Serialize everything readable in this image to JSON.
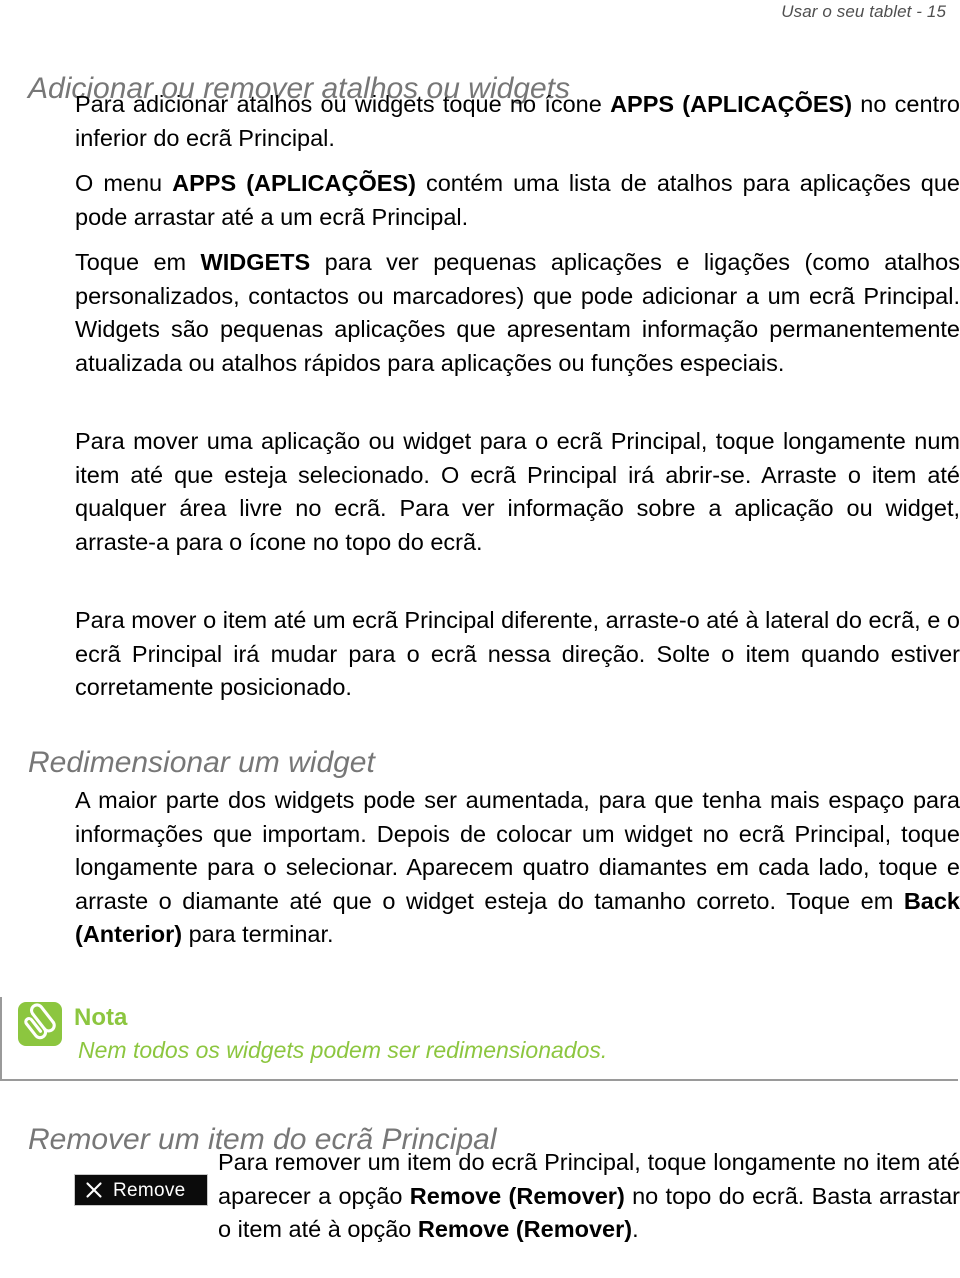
{
  "header": {
    "running_head": "Usar o seu tablet - 15"
  },
  "colors": {
    "heading_gray": "#777777",
    "note_green": "#8cc63f",
    "note_border": "#9a9a9a",
    "body_black": "#000000",
    "remove_button_bg": "#0b0b0b"
  },
  "sections": {
    "add_remove": {
      "heading": "Adicionar ou remover atalhos ou widgets",
      "paragraphs": {
        "p1_a": "Para adicionar atalhos ou widgets toque no ícone ",
        "p1_bold": "APPS (APLICAÇÕES)",
        "p1_b": " no centro inferior do ecrã Principal.",
        "p2_a": "O menu ",
        "p2_bold": "APPS (APLICAÇÕES)",
        "p2_b": " contém uma lista de atalhos para aplicações que pode arrastar até a um ecrã Principal.",
        "p3_a": "Toque em ",
        "p3_bold": "WIDGETS",
        "p3_b": " para ver pequenas aplicações e ligações (como atalhos personalizados, contactos ou marcadores) que pode adicionar a um ecrã Principal. Widgets são pequenas aplicações que apresentam informação permanentemente atualizada ou atalhos rápidos para aplicações ou funções especiais.",
        "p4": "Para mover uma aplicação ou widget para o ecrã Principal, toque longamente num item até que esteja selecionado. O ecrã Principal irá abrir-se. Arraste o item até qualquer área livre no ecrã. Para ver informação sobre a aplicação ou widget, arraste-a para o ícone no topo do ecrã.",
        "p5": "Para mover o item até um ecrã Principal diferente, arraste-o até à lateral do ecrã, e o ecrã Principal irá mudar para o ecrã nessa direção. Solte o item quando estiver corretamente posicionado."
      }
    },
    "resize": {
      "heading": "Redimensionar um widget",
      "paragraph_a": "A maior parte dos widgets pode ser aumentada, para que tenha mais espaço para informações que importam. Depois de colocar um widget no ecrã Principal, toque longamente para o selecionar. Aparecem quatro diamantes em cada lado, toque e arraste o diamante até que o widget esteja do tamanho correto. Toque em ",
      "paragraph_bold": "Back (Anterior)",
      "paragraph_b": " para terminar."
    },
    "note": {
      "icon_name": "paperclip-icon",
      "title": "Nota",
      "text": "Nem todos os widgets podem ser redimensionados."
    },
    "remove_item": {
      "heading": "Remover um item do ecrã Principal",
      "button": {
        "icon_name": "close-x-icon",
        "label": "Remove"
      },
      "paragraph_a": "Para remover um item do ecrã Principal, toque longamente no item até aparecer a opção ",
      "paragraph_bold1": "Remove (Remover)",
      "paragraph_b": " no topo do ecrã. Basta arrastar o item até à opção ",
      "paragraph_bold2": "Remove (Remover)",
      "paragraph_c": "."
    }
  }
}
